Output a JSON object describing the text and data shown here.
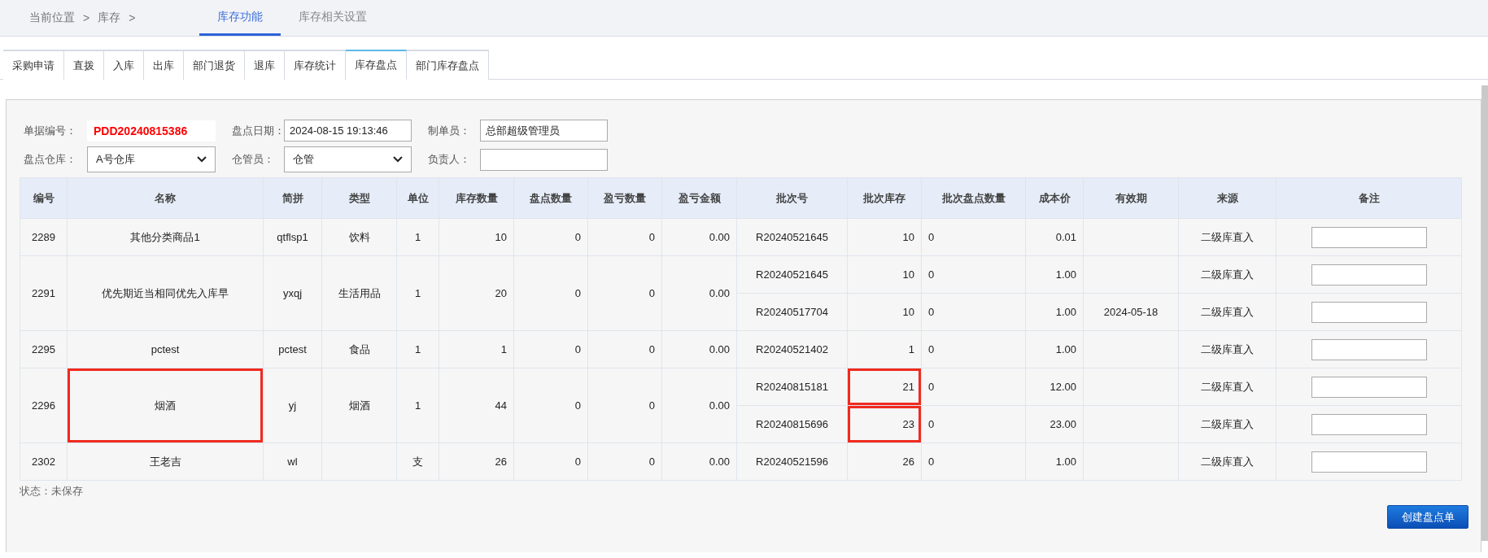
{
  "breadcrumb": [
    "当前位置",
    ">",
    "库存",
    ">"
  ],
  "top_tabs": [
    {
      "label": "库存功能",
      "selected": true
    },
    {
      "label": "库存相关设置",
      "selected": false
    }
  ],
  "sub_tabs": [
    {
      "label": "采购申请",
      "selected": false
    },
    {
      "label": "直拨",
      "selected": false
    },
    {
      "label": "入库",
      "selected": false
    },
    {
      "label": "出库",
      "selected": false
    },
    {
      "label": "部门退货",
      "selected": false
    },
    {
      "label": "退库",
      "selected": false
    },
    {
      "label": "库存统计",
      "selected": false
    },
    {
      "label": "库存盘点",
      "selected": true
    },
    {
      "label": "部门库存盘点",
      "selected": false
    }
  ],
  "form": {
    "rows": [
      [
        {
          "label": "单据编号：",
          "kind": "code",
          "value": "PDD20240815386"
        },
        {
          "label": "盘点日期：",
          "kind": "input",
          "value": "2024-08-15 19:13:46"
        },
        {
          "label": "制单员：",
          "kind": "input",
          "value": "总部超级管理员"
        }
      ],
      [
        {
          "label": "盘点仓库：",
          "kind": "select",
          "value": "A号仓库"
        },
        {
          "label": "仓管员：",
          "kind": "select",
          "value": "仓管"
        },
        {
          "label": "负责人：",
          "kind": "input"
        }
      ]
    ]
  },
  "table": {
    "columns": [
      "编号",
      "名称",
      "简拼",
      "类型",
      "单位",
      "库存数量",
      "盘点数量",
      "盈亏数量",
      "盈亏金额",
      "批次号",
      "批次库存",
      "批次盘点数量",
      "成本价",
      "有效期",
      "来源",
      "备注"
    ],
    "rows": [
      {
        "id": "2289",
        "name": "其他分类商品1",
        "abbr": "qtflsp1",
        "type": "饮料",
        "unit": "1",
        "stock": "10",
        "counted": "0",
        "diff_qty": "0",
        "diff_amount": "0.00",
        "highlight_name": false,
        "batches": [
          {
            "batch_no": "R20240521645",
            "batch_stock": "10",
            "batch_counted": "0",
            "cost": "0.01",
            "source": "二级库直入",
            "highlight_stock": false
          }
        ]
      },
      {
        "id": "2291",
        "name": "优先期近当相同优先入库早",
        "abbr": "yxqj",
        "type": "生活用品",
        "unit": "1",
        "stock": "20",
        "counted": "0",
        "diff_qty": "0",
        "diff_amount": "0.00",
        "highlight_name": false,
        "batches": [
          {
            "batch_no": "R20240521645",
            "batch_stock": "10",
            "batch_counted": "0",
            "cost": "1.00",
            "source": "二级库直入",
            "highlight_stock": false
          },
          {
            "batch_no": "R20240517704",
            "batch_stock": "10",
            "batch_counted": "0",
            "cost": "1.00",
            "expiry": "2024-05-18",
            "source": "二级库直入",
            "highlight_stock": false
          }
        ]
      },
      {
        "id": "2295",
        "name": "pctest",
        "abbr": "pctest",
        "type": "食品",
        "unit": "1",
        "stock": "1",
        "counted": "0",
        "diff_qty": "0",
        "diff_amount": "0.00",
        "highlight_name": false,
        "batches": [
          {
            "batch_no": "R20240521402",
            "batch_stock": "1",
            "batch_counted": "0",
            "cost": "1.00",
            "source": "二级库直入",
            "highlight_stock": false
          }
        ]
      },
      {
        "id": "2296",
        "name": "烟酒",
        "abbr": "yj",
        "type": "烟酒",
        "unit": "1",
        "stock": "44",
        "counted": "0",
        "diff_qty": "0",
        "diff_amount": "0.00",
        "highlight_name": true,
        "batches": [
          {
            "batch_no": "R20240815181",
            "batch_stock": "21",
            "batch_counted": "0",
            "cost": "12.00",
            "source": "二级库直入",
            "highlight_stock": true
          },
          {
            "batch_no": "R20240815696",
            "batch_stock": "23",
            "batch_counted": "0",
            "cost": "23.00",
            "source": "二级库直入",
            "highlight_stock": true
          }
        ]
      },
      {
        "id": "2302",
        "name": "王老吉",
        "abbr": "wl",
        "unit": "支",
        "stock": "26",
        "counted": "0",
        "diff_qty": "0",
        "diff_amount": "0.00",
        "highlight_name": false,
        "batches": [
          {
            "batch_no": "R20240521596",
            "batch_stock": "26",
            "batch_counted": "0",
            "cost": "1.00",
            "source": "二级库直入",
            "highlight_stock": false
          }
        ]
      }
    ]
  },
  "status": "状态：未保存",
  "create_button": "创建盘点单"
}
